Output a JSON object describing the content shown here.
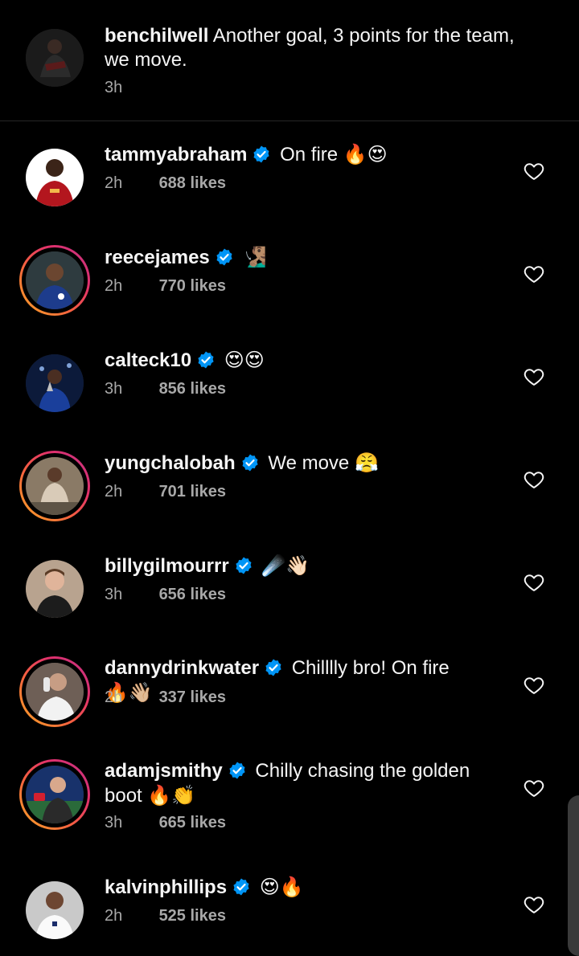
{
  "caption": {
    "username": "benchilwell",
    "text": "Another goal, 3 points for the team, we move.",
    "time": "3h",
    "avatar_icon": "avatar-benchilwell"
  },
  "comments": [
    {
      "username": "tammyabraham",
      "text": "On fire",
      "emoji": "🔥😍",
      "time": "2h",
      "likes": "688 likes",
      "story_ring": false
    },
    {
      "username": "reecejames",
      "text": "",
      "emoji": "🧏🏽‍♂️",
      "time": "2h",
      "likes": "770 likes",
      "story_ring": true
    },
    {
      "username": "calteck10",
      "text": "",
      "emoji": "😍😍",
      "time": "3h",
      "likes": "856 likes",
      "story_ring": false
    },
    {
      "username": "yungchalobah",
      "text": "We move",
      "emoji": "😤",
      "time": "2h",
      "likes": "701 likes",
      "story_ring": true
    },
    {
      "username": "billygilmourrr",
      "text": "",
      "emoji": "☄️👋🏻",
      "time": "3h",
      "likes": "656 likes",
      "story_ring": false
    },
    {
      "username": "dannydrinkwater",
      "text": "Chilllly bro! On fire",
      "emoji": "🔥👋🏼",
      "time": "2h",
      "likes": "337 likes",
      "story_ring": true
    },
    {
      "username": "adamjsmithy",
      "text": "Chilly chasing the golden boot",
      "emoji": "🔥👏",
      "time": "3h",
      "likes": "665 likes",
      "story_ring": true
    },
    {
      "username": "kalvinphillips",
      "text": "",
      "emoji": "😍🔥",
      "time": "2h",
      "likes": "525 likes",
      "story_ring": false
    }
  ],
  "colors": {
    "background": "#000000",
    "text": "#f5f5f5",
    "secondary_text": "#a8a8a8",
    "verified_badge": "#0095f6",
    "divider": "#262626"
  },
  "icons": {
    "verified": "verified-badge-icon",
    "like": "heart-outline-icon"
  }
}
